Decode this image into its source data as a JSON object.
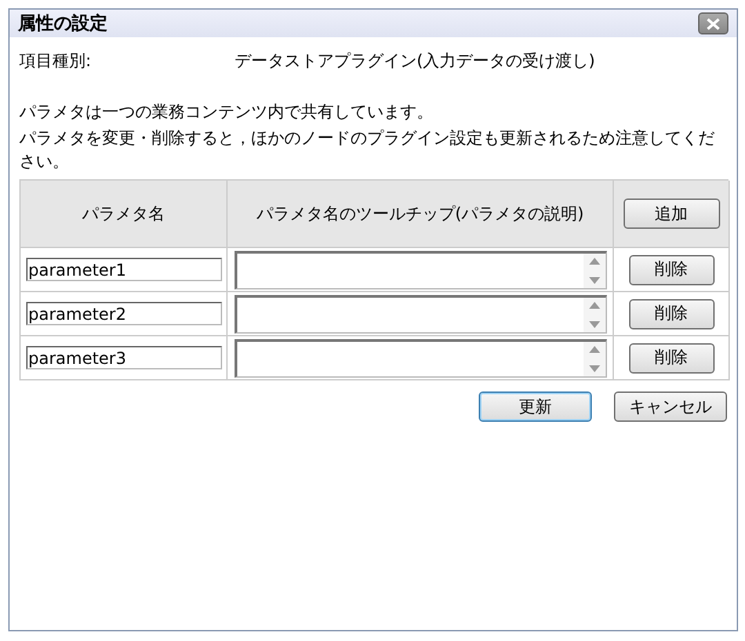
{
  "window": {
    "title": "属性の設定"
  },
  "item_type": {
    "label": "項目種別:",
    "value": "データストアプラグイン(入力データの受け渡し)"
  },
  "notes": [
    "パラメタは一つの業務コンテンツ内で共有しています。",
    "パラメタを変更・削除すると，ほかのノードのプラグイン設定も更新されるため注意してください。"
  ],
  "table": {
    "columns": [
      "パラメタ名",
      "パラメタ名のツールチップ(パラメタの説明)"
    ],
    "add_button": "追加",
    "rows": [
      {
        "name": "parameter1",
        "button": "削除"
      },
      {
        "name": "parameter2",
        "button": "削除"
      },
      {
        "name": "parameter3",
        "button": "削除"
      }
    ]
  },
  "buttons": [
    {
      "label": "更新",
      "default": true
    },
    {
      "label": "キャンセル",
      "default": false
    }
  ]
}
